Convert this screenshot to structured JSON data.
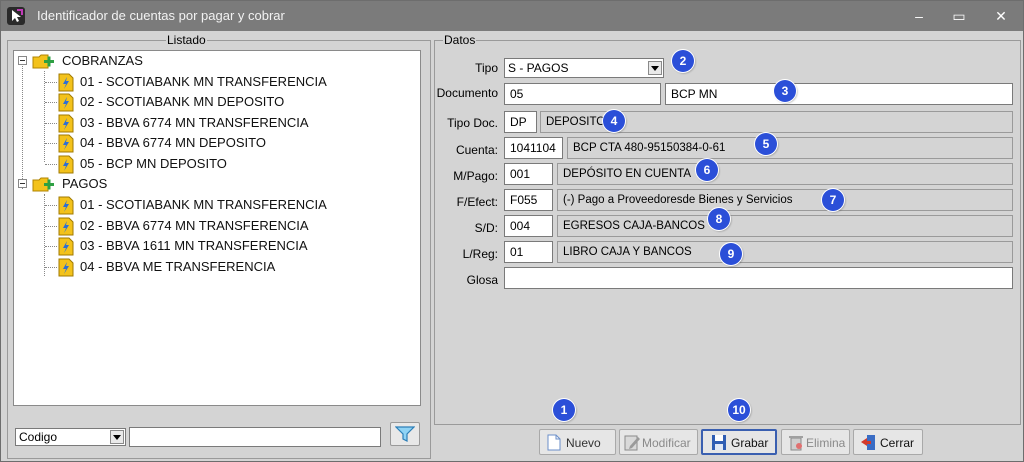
{
  "window": {
    "title": "Identificador de cuentas por pagar y cobrar",
    "minimize_symbol": "–",
    "maximize_symbol": "▭",
    "close_symbol": "✕"
  },
  "listado": {
    "legend": "Listado",
    "groups": [
      {
        "label": "COBRANZAS",
        "icon": "folder-plus-icon",
        "items": [
          "01 - SCOTIABANK MN TRANSFERENCIA",
          "02 - SCOTIABANK MN DEPOSITO",
          "03 - BBVA 6774 MN TRANSFERENCIA",
          "04 - BBVA 6774 MN DEPOSITO",
          "05 - BCP MN DEPOSITO"
        ]
      },
      {
        "label": "PAGOS",
        "icon": "folder-plus-icon",
        "items": [
          "01 - SCOTIABANK MN TRANSFERENCIA",
          "02 - BBVA 6774 MN TRANSFERENCIA",
          "03 - BBVA 1611 MN TRANSFERENCIA",
          "04 - BBVA ME TRANSFERENCIA"
        ]
      }
    ],
    "search_field_select": "Codigo",
    "search_value": ""
  },
  "datos": {
    "legend": "Datos",
    "tipo": {
      "label": "Tipo",
      "value": "S - PAGOS"
    },
    "documento": {
      "label": "Documento",
      "code": "05",
      "name": "BCP MN"
    },
    "tipo_doc": {
      "label": "Tipo Doc.",
      "code": "DP",
      "desc": "DEPOSITO"
    },
    "cuenta": {
      "label": "Cuenta:",
      "code": "1041104",
      "desc": "BCP CTA 480-95150384-0-61"
    },
    "m_pago": {
      "label": "M/Pago:",
      "code": "001",
      "desc": "DEPÓSITO EN CUENTA"
    },
    "f_efect": {
      "label": "F/Efect:",
      "code": "F055",
      "desc": "(-) Pago a Proveedoresde Bienes y Servicios"
    },
    "s_d": {
      "label": "S/D:",
      "code": "004",
      "desc": "EGRESOS CAJA-BANCOS"
    },
    "l_reg": {
      "label": "L/Reg:",
      "code": "01",
      "desc": "LIBRO CAJA Y BANCOS"
    },
    "glosa": {
      "label": "Glosa",
      "value": ""
    }
  },
  "buttons": {
    "nuevo": "Nuevo",
    "modificar": "Modificar",
    "grabar": "Grabar",
    "elimina": "Elimina",
    "cerrar": "Cerrar"
  },
  "badges": [
    "1",
    "2",
    "3",
    "4",
    "5",
    "6",
    "7",
    "8",
    "9",
    "10"
  ],
  "colors": {
    "titlebar": "#7b7b7b",
    "badge": "#2b4fd8",
    "panel": "#d4d4d4",
    "folder": "#f3c21b",
    "plus": "#2ea043"
  }
}
